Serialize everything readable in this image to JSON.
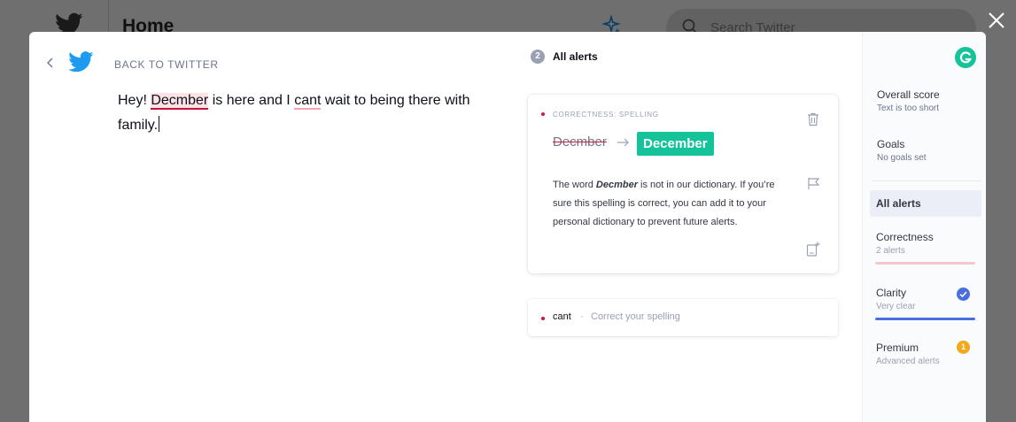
{
  "background": {
    "title": "Home",
    "search_placeholder": "Search Twitter"
  },
  "modal": {
    "back_label": "BACK TO TWITTER",
    "editor": {
      "segments": [
        "Hey! ",
        "Decmber",
        " is here and I ",
        "cant",
        " wait to being there with family."
      ]
    },
    "alerts_header": {
      "count": "2",
      "title": "All alerts"
    },
    "active_alert": {
      "category": "CORRECTNESS: SPELLING",
      "wrong_word": "Decmber",
      "suggestion": "December",
      "description_pre": "The word ",
      "description_word": "Decmber",
      "description_post": " is not in our dictionary. If you’re sure this spelling is correct, you can add it to your personal dictionary to prevent future alerts."
    },
    "collapsed_alert": {
      "word": "cant",
      "separator": "·",
      "description": "Correct your spelling"
    },
    "sidebar": {
      "overall_score": {
        "title": "Overall score",
        "sub": "Text is too short"
      },
      "goals": {
        "title": "Goals",
        "sub": "No goals set"
      },
      "all_alerts": {
        "title": "All alerts"
      },
      "correctness": {
        "title": "Correctness",
        "sub": "2 alerts",
        "color": "#f7c7cf"
      },
      "clarity": {
        "title": "Clarity",
        "sub": "Very clear",
        "color": "#4a6ee0"
      },
      "premium": {
        "title": "Premium",
        "sub": "Advanced alerts",
        "badge": "1",
        "color": "#f3a81c"
      }
    }
  },
  "colors": {
    "accent_green": "#15c39a",
    "error_red": "#d0173d",
    "twitter_blue": "#1d9bf0"
  },
  "icons": [
    "twitter-bird-icon",
    "sparkle-icon",
    "search-icon",
    "close-icon",
    "chevron-left-icon",
    "trash-icon",
    "arrow-right-icon",
    "flag-icon",
    "add-to-dictionary-icon",
    "grammarly-logo-icon",
    "check-circle-icon"
  ]
}
